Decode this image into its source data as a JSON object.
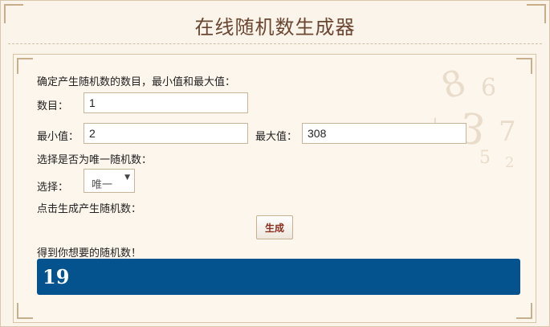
{
  "header": {
    "title": "在线随机数生成器"
  },
  "form": {
    "intro": "确定产生随机数的数目，最小值和最大值：",
    "count_label": "数目：",
    "count_value": "1",
    "min_label": "最小值：",
    "min_value": "2",
    "max_label": "最大值：",
    "max_value": "308",
    "unique_question": "选择是否为唯一随机数：",
    "select_label": "选择：",
    "select_value": "唯一",
    "generate_prompt": "点击生成产生随机数：",
    "generate_button": "生成",
    "result_label": "得到你想要的随机数！",
    "result_value": "19"
  },
  "colors": {
    "result_bg": "#04538f",
    "title": "#6b4630",
    "button_text": "#8a2f1e"
  }
}
